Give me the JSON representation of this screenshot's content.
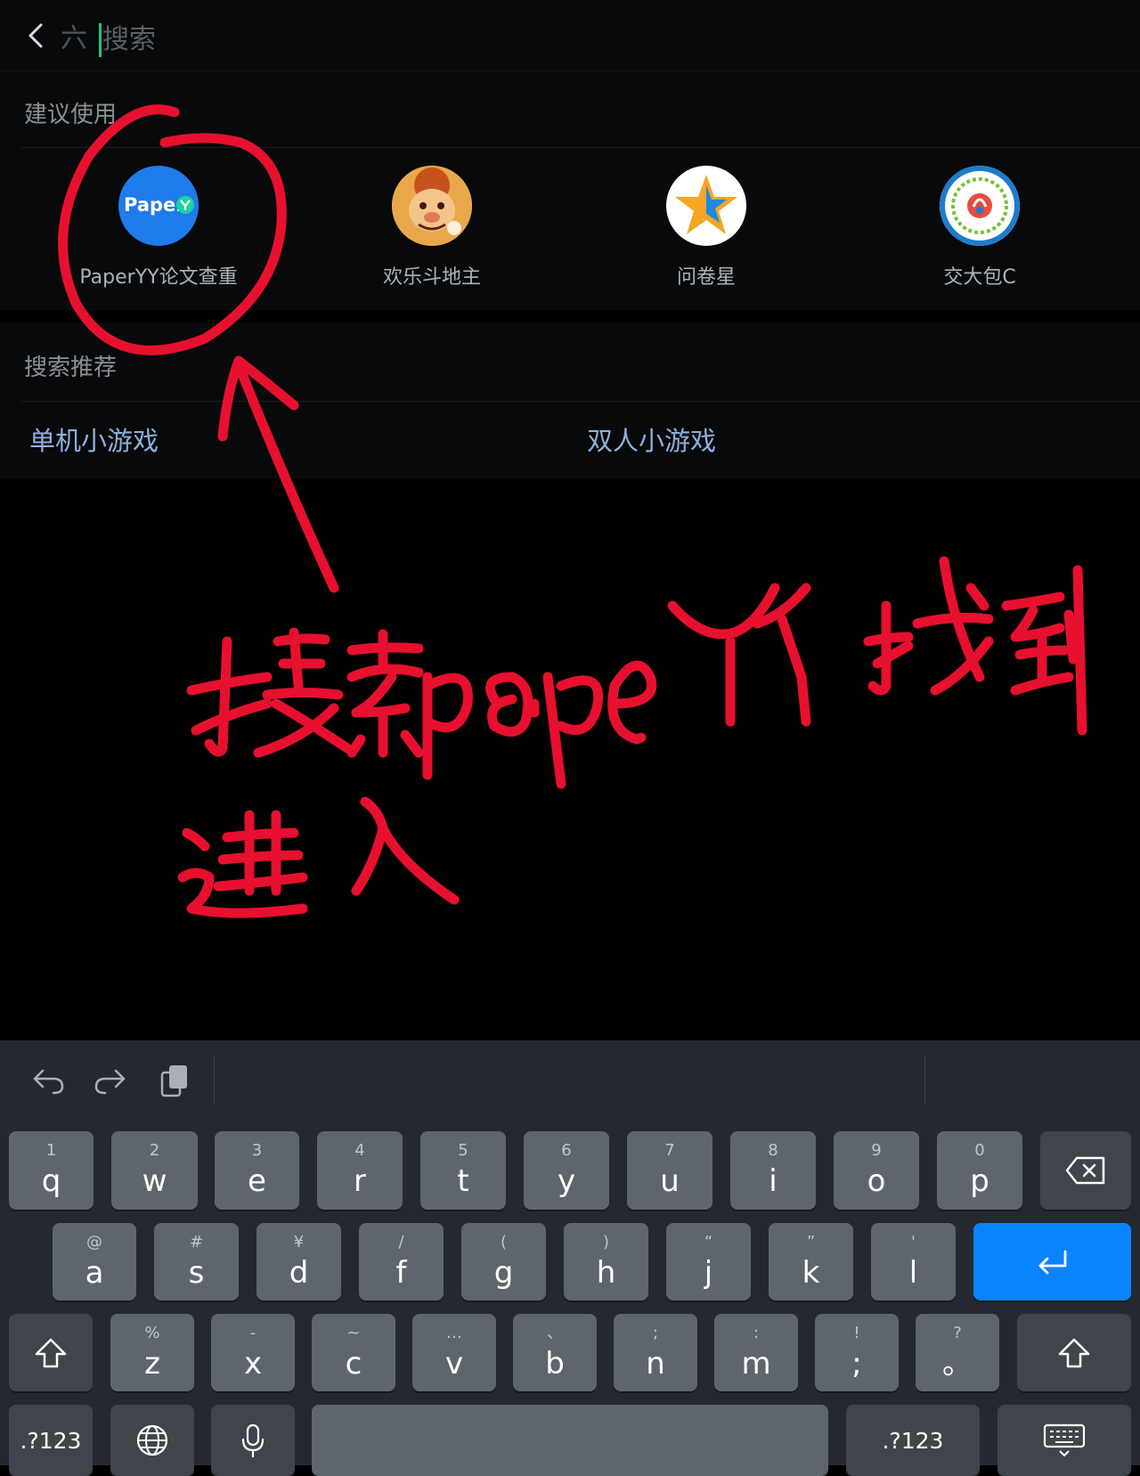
{
  "header": {
    "back_icon": "chevron-left-icon",
    "prefix_icon_glyph": "六",
    "search_placeholder": "搜索"
  },
  "suggested": {
    "title": "建议使用",
    "apps": [
      {
        "label": "PaperYY论文查重",
        "icon_text": "Paper",
        "icon_color": "#1e7bea"
      },
      {
        "label": "欢乐斗地主",
        "icon": "cartoon-character-icon"
      },
      {
        "label": "问卷星",
        "icon": "star-icon"
      },
      {
        "label": "交大包C",
        "icon": "school-emblem-icon"
      }
    ]
  },
  "recommend": {
    "title": "搜索推荐",
    "items": [
      "单机小游戏",
      "双人小游戏"
    ]
  },
  "annotation": {
    "color": "#e8102f",
    "text_line_1": "搜索pape YY 找到",
    "text_line_2": "进入"
  },
  "keyboard": {
    "row1": [
      {
        "hint": "1",
        "key": "q"
      },
      {
        "hint": "2",
        "key": "w"
      },
      {
        "hint": "3",
        "key": "e"
      },
      {
        "hint": "4",
        "key": "r"
      },
      {
        "hint": "5",
        "key": "t"
      },
      {
        "hint": "6",
        "key": "y"
      },
      {
        "hint": "7",
        "key": "u"
      },
      {
        "hint": "8",
        "key": "i"
      },
      {
        "hint": "9",
        "key": "o"
      },
      {
        "hint": "0",
        "key": "p"
      }
    ],
    "row2": [
      {
        "hint": "@",
        "key": "a"
      },
      {
        "hint": "#",
        "key": "s"
      },
      {
        "hint": "¥",
        "key": "d"
      },
      {
        "hint": "/",
        "key": "f"
      },
      {
        "hint": "(",
        "key": "g"
      },
      {
        "hint": ")",
        "key": "h"
      },
      {
        "hint": "“",
        "key": "j"
      },
      {
        "hint": "”",
        "key": "k"
      },
      {
        "hint": "'",
        "key": "l"
      }
    ],
    "row3": [
      {
        "hint": "%",
        "key": "z"
      },
      {
        "hint": "-",
        "key": "x"
      },
      {
        "hint": "~",
        "key": "c"
      },
      {
        "hint": "…",
        "key": "v"
      },
      {
        "hint": "、",
        "key": "b"
      },
      {
        "hint": ";",
        "key": "n"
      },
      {
        "hint": ":",
        "key": "m"
      },
      {
        "hint": "!",
        "key": ";"
      },
      {
        "hint": "?",
        "key": "。"
      }
    ],
    "symbols_label": ".?123",
    "accent_color": "#0a84ff"
  }
}
